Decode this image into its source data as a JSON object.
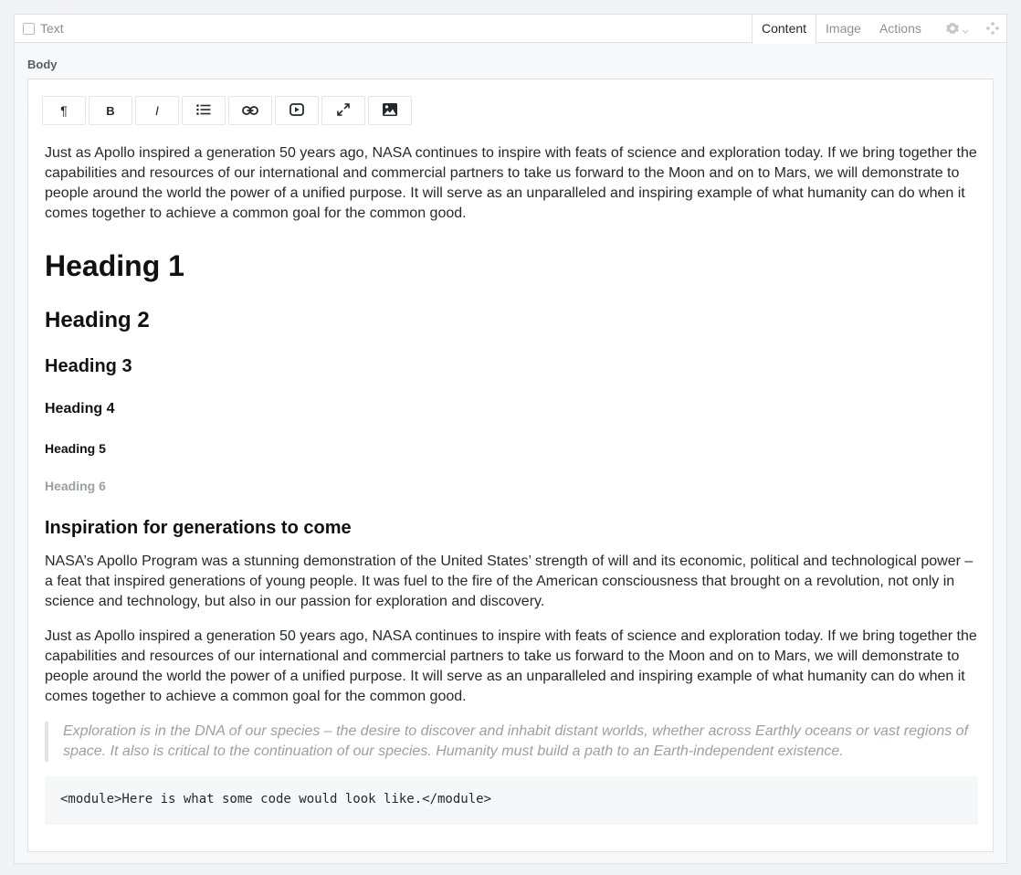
{
  "block": {
    "title": "Text"
  },
  "tabs": [
    {
      "label": "Content",
      "active": true
    },
    {
      "label": "Image",
      "active": false
    },
    {
      "label": "Actions",
      "active": false
    }
  ],
  "field": {
    "label": "Body"
  },
  "toolbar": {
    "paragraph_label": "¶",
    "bold_label": "B",
    "italic_label": "I"
  },
  "icons": {
    "gear": "gear-icon",
    "chevron": "chevron-down-icon",
    "drag": "drag-handle-icon",
    "list": "list-icon",
    "link": "link-icon",
    "video": "video-icon",
    "fullscreen": "fullscreen-icon",
    "image": "image-icon"
  },
  "content": {
    "intro": "Just as Apollo inspired a generation 50 years ago, NASA continues to inspire with feats of science and exploration today. If we bring together the capabilities and resources of our international and commercial partners to take us forward to the Moon and on to Mars, we will demonstrate to people around the world the power of a unified purpose. It will serve as an unparalleled and inspiring example of what humanity can do when it comes together to achieve a common goal for the common good.",
    "h1": "Heading 1",
    "h2": "Heading 2",
    "h3": "Heading 3",
    "h4": "Heading 4",
    "h5": "Heading 5",
    "h6": "Heading 6",
    "section_heading": "Inspiration for generations to come",
    "para1": "NASA’s Apollo Program was a stunning demonstration of the United States’ strength of will and its economic, political and technological power – a feat that inspired generations of young people. It was fuel to the fire of the American consciousness that brought on a revolution, not only in science and technology, but also in our passion for exploration and discovery.",
    "para2": "Just as Apollo inspired a generation 50 years ago, NASA continues to inspire with feats of science and exploration today. If we bring together the capabilities and resources of our international and commercial partners to take us forward to the Moon and on to Mars, we will demonstrate to people around the world the power of a unified purpose. It will serve as an unparalleled and inspiring example of what humanity can do when it comes together to achieve a common goal for the common good.",
    "quote": "Exploration is in the DNA of our species – the desire to discover and inhabit distant worlds, whether across Earthly oceans or vast regions of space. It also is critical to the continuation of our species. Humanity must build a path to an Earth-independent existence.",
    "code": "<module>Here is what some code would look like.</module>"
  }
}
